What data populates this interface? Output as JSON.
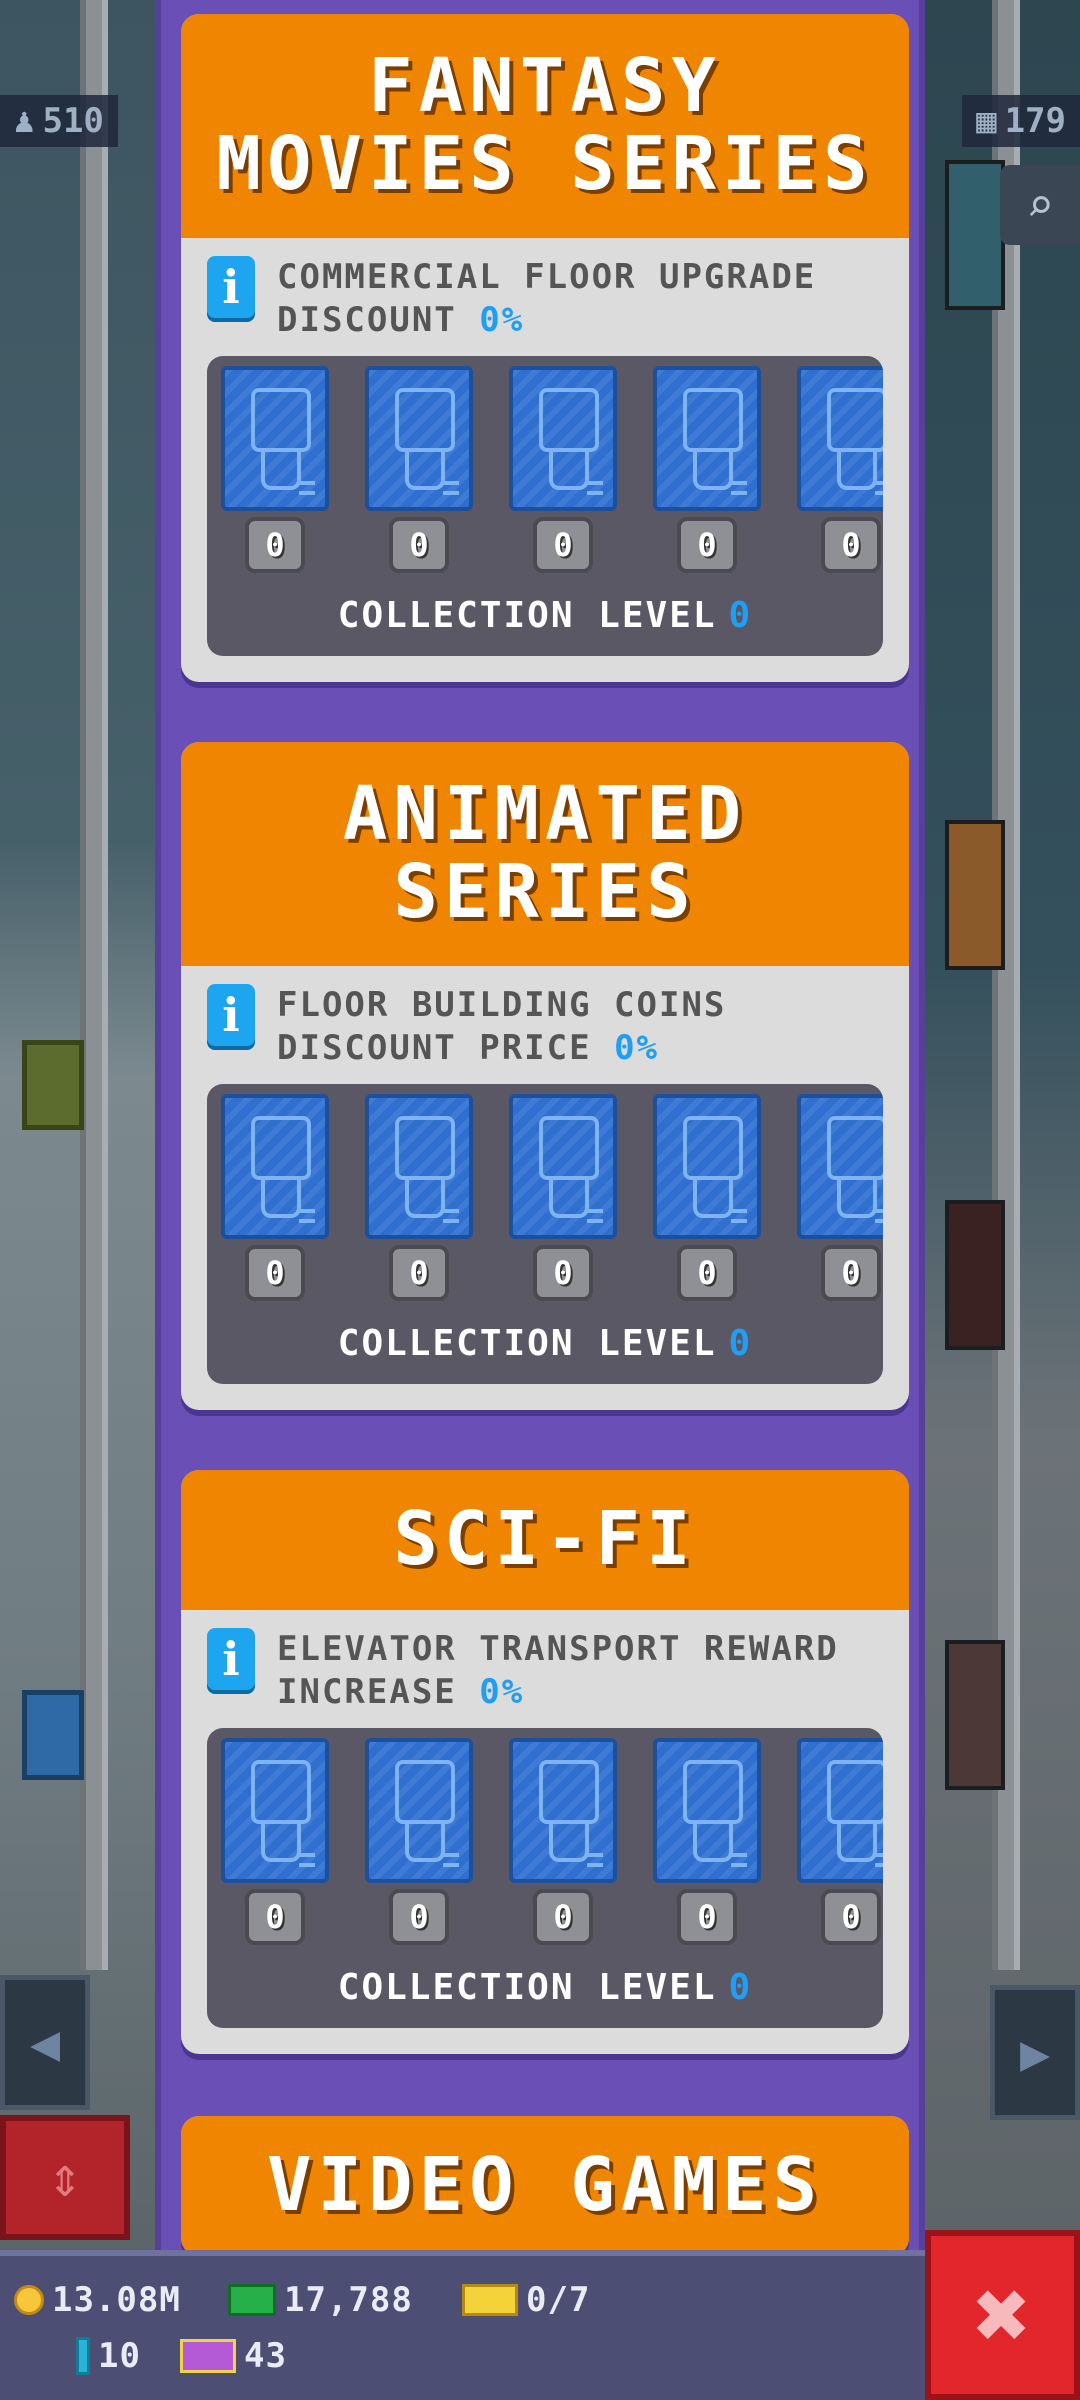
{
  "hud": {
    "residents_count": "510",
    "floors_count": "179"
  },
  "collections": [
    {
      "title": "FANTASY\nMOVIES SERIES",
      "bonus_label": "COMMERCIAL FLOOR UPGRADE DISCOUNT",
      "bonus_value": "0%",
      "card_counts": [
        "0",
        "0",
        "0",
        "0",
        "0"
      ],
      "level_label": "COLLECTION LEVEL",
      "level_value": "0"
    },
    {
      "title": "ANIMATED\nSERIES",
      "bonus_label": "FLOOR BUILDING COINS DISCOUNT PRICE",
      "bonus_value": "0%",
      "card_counts": [
        "0",
        "0",
        "0",
        "0",
        "0"
      ],
      "level_label": "COLLECTION LEVEL",
      "level_value": "0"
    },
    {
      "title": "SCI-FI",
      "bonus_label": "ELEVATOR TRANSPORT REWARD INCREASE",
      "bonus_value": "0%",
      "card_counts": [
        "0",
        "0",
        "0",
        "0",
        "0"
      ],
      "level_label": "COLLECTION LEVEL",
      "level_value": "0"
    },
    {
      "title": "VIDEO GAMES"
    }
  ],
  "resources": {
    "coins": "13.08M",
    "bux": "17,788",
    "tickets": "0/7",
    "gems": "10",
    "tv_tickets": "43"
  },
  "colors": {
    "panel": "#6a4fb6",
    "header": "#ef8500",
    "accent_blue": "#1f9ef5",
    "close_red": "#e2262c"
  },
  "icons": {
    "info": "info-icon",
    "close": "close-icon",
    "coin": "coin-icon",
    "bux": "bux-icon",
    "ticket": "ticket-icon",
    "gem": "gem-icon",
    "tv": "tv-ticket-icon"
  }
}
